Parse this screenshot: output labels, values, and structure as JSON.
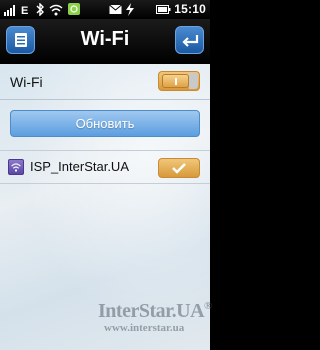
{
  "status_bar": {
    "time": "15:10",
    "icons": [
      "signal-icon",
      "e-data-icon",
      "bluetooth-icon",
      "wifi-signal-icon",
      "gps-icon",
      "message-icon",
      "battery-icon"
    ]
  },
  "header": {
    "title": "Wi-Fi",
    "menu_icon": "menu-icon",
    "back_icon": "back-arrow-icon"
  },
  "wifi_setting": {
    "label": "Wi-Fi",
    "state": "on"
  },
  "refresh_button": {
    "label": "Обновить"
  },
  "networks": [
    {
      "name": "ISP_InterStar.UA",
      "connected": true
    }
  ],
  "watermark": {
    "brand": "InterStar.UA",
    "registered": "®",
    "url": "www.interstar.ua"
  },
  "colors": {
    "accent_blue": "#5c9ee0",
    "toggle_orange": "#d8993a",
    "background": "#dfe8ee"
  }
}
